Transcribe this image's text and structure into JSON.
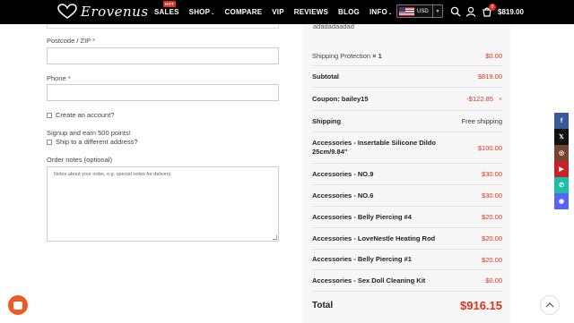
{
  "header": {
    "logo_text": "Erovenus",
    "hot_badge": "HOT",
    "nav": [
      "SALES",
      "SHOP",
      "COMPARE",
      "VIP",
      "REVIEWS",
      "BLOG",
      "INFO"
    ],
    "currency": "USD",
    "cart_count": "0",
    "cart_total": "$819.00"
  },
  "form": {
    "postcode_label": "Postcode / ZIP",
    "phone_label": "Phone",
    "required_mark": "*",
    "create_account": "Create an account?",
    "signup_text": "Signup and earn 500 points!",
    "ship_different": "Ship to a different address?",
    "notes_label": "Order notes (optional)",
    "notes_placeholder": "Notes about your order, e.g. special notes for delivery."
  },
  "summary": {
    "address_text": "adadadaadad",
    "shipping_protection": {
      "label": "Shipping Protection",
      "qty": "× 1",
      "value": "$0.00"
    },
    "subtotal": {
      "label": "Subtotal",
      "value": "$819.00"
    },
    "coupon": {
      "label": "Coupon: bailey15",
      "value": "-$122.85",
      "remove": "×"
    },
    "shipping": {
      "label": "Shipping",
      "value": "Free shipping"
    },
    "items": [
      {
        "name": "Accessories - Insertable Silicone Dildo 25cm/9.84''",
        "price": "$100.00"
      },
      {
        "name": "Accessories - NO.9",
        "price": "$30.00"
      },
      {
        "name": "Accessories - NO.6",
        "price": "$30.00"
      },
      {
        "name": "Accessories - Belly Piercing #4",
        "price": "$20.00"
      },
      {
        "name": "Accessories - LoveNestle Heating Rod",
        "price": "$20.00"
      },
      {
        "name": "Accessories - Belly Piercing #1",
        "price": "$20.00"
      },
      {
        "name": "Accessories - Sex Doll Cleaning Kit",
        "price": "$0.00"
      }
    ],
    "total": {
      "label": "Total",
      "value": "$916.15"
    }
  },
  "social": [
    {
      "icon": "facebook-icon",
      "glyph": "f",
      "color": "#3b5998"
    },
    {
      "icon": "x-icon",
      "glyph": "𝕏",
      "color": "#111111"
    },
    {
      "icon": "instagram-icon",
      "glyph": "◎",
      "color": "#774430"
    },
    {
      "icon": "youtube-icon",
      "glyph": "▶",
      "color": "#cb2027"
    },
    {
      "icon": "whatsapp-icon",
      "glyph": "✆",
      "color": "#1ebea5"
    },
    {
      "icon": "discord-icon",
      "glyph": "◉",
      "color": "#5865f2"
    }
  ],
  "colors": {
    "accent": "#e0301e",
    "header_bg": "#000000",
    "summary_bg": "#f7f7f7"
  }
}
